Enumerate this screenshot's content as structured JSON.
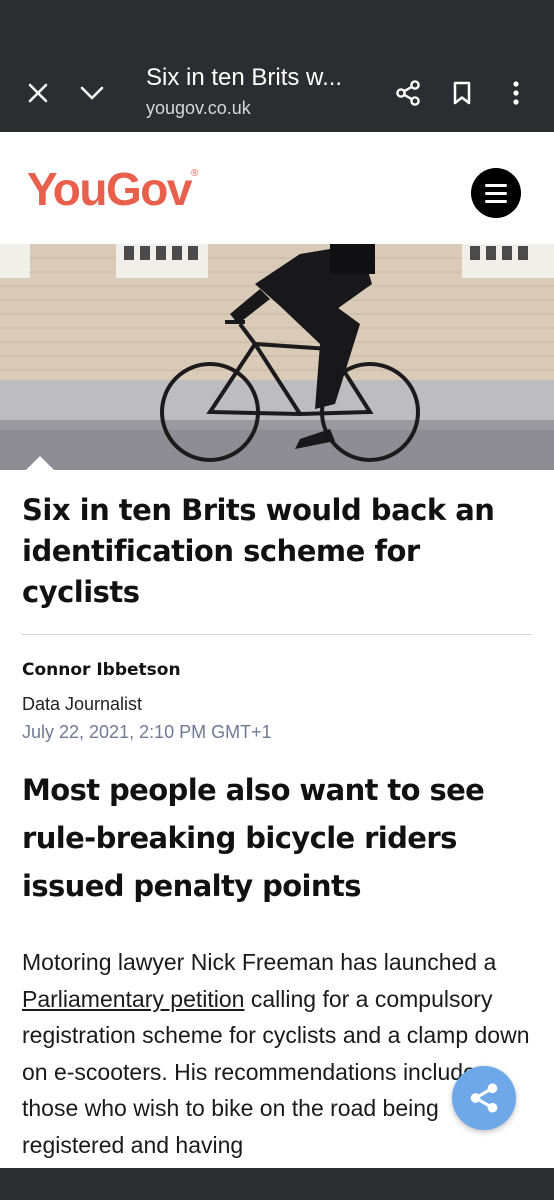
{
  "browser": {
    "title": "Six in ten Brits w...",
    "domain": "yougov.co.uk",
    "icons": [
      "close-icon",
      "chevron-down-icon",
      "share-icon",
      "bookmark-icon",
      "more-vert-icon"
    ]
  },
  "site": {
    "logo_text": "YouGov",
    "logo_mark": "®",
    "brand_color": "#e8604c"
  },
  "article": {
    "headline": "Six in ten Brits would back an identification scheme for cyclists",
    "author": "Connor Ibbetson",
    "role": "Data Journalist",
    "date": "July 22, 2021, 2:10 PM GMT+1",
    "subheadline": "Most people also want to see rule-breaking bicycle riders issued penalty points",
    "body_before_link": "Motoring lawyer Nick Freeman has launched a ",
    "body_link": "Parliamentary petition",
    "body_after_link": " calling for a compulsory registration scheme for cyclists and a clamp down on e-scooters. His recommendations include those who wish to bike on the road being registered and having"
  },
  "colors": {
    "chrome_bg": "#2c2d30",
    "date_color": "#6f7a95",
    "fab_color": "#6ea8e8"
  }
}
